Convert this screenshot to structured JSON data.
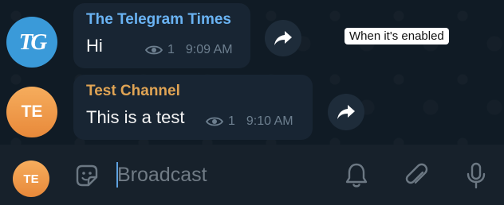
{
  "messages": [
    {
      "avatar_text": "TG",
      "sender": "The Telegram Times",
      "text": "Hi",
      "views": "1",
      "time": "9:09 AM",
      "icon": "forward-icon"
    },
    {
      "avatar_text": "TE",
      "sender": "Test Channel",
      "text": "This is a test",
      "views": "1",
      "time": "9:10 AM",
      "icon": "forward-icon"
    }
  ],
  "tooltip": "When it's enabled",
  "composer": {
    "avatar_text": "TE",
    "placeholder": "Broadcast",
    "icons": [
      "sticker-icon",
      "bell-icon",
      "attach-icon",
      "mic-icon"
    ]
  },
  "colors": {
    "background": "#0e1621",
    "bubble": "#182533",
    "sender_telegram_times": "#6ab3f3",
    "sender_test_channel": "#e0a454",
    "meta": "#6d7f8f",
    "composer": "#17212b"
  }
}
